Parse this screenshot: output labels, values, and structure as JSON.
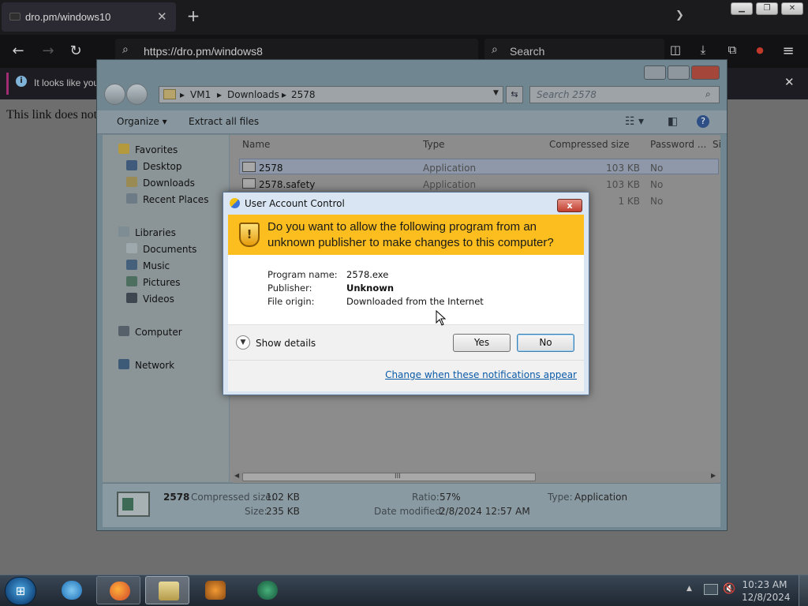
{
  "browser": {
    "tab_title": "dro.pm/windows10",
    "url": "https://dro.pm/windows8",
    "search_placeholder": "Search",
    "notice_text": "It looks like you",
    "page_text": "This link does not"
  },
  "explorer": {
    "breadcrumb": [
      "VM1",
      "Downloads",
      "2578"
    ],
    "search_placeholder": "Search 2578",
    "commands": {
      "organize": "Organize",
      "extract_all": "Extract all files"
    },
    "nav": {
      "favorites": "Favorites",
      "favorites_items": [
        "Desktop",
        "Downloads",
        "Recent Places"
      ],
      "libraries": "Libraries",
      "libraries_items": [
        "Documents",
        "Music",
        "Pictures",
        "Videos"
      ],
      "computer": "Computer",
      "network": "Network"
    },
    "columns": [
      "Name",
      "Type",
      "Compressed size",
      "Password ...",
      "Si"
    ],
    "files": [
      {
        "name": "2578",
        "type": "Application",
        "size": "103 KB",
        "password": "No"
      },
      {
        "name": "2578.safety",
        "type": "Application",
        "size": "103 KB",
        "password": "No"
      },
      {
        "name": "",
        "type": "",
        "size": "1 KB",
        "password": "No"
      }
    ],
    "details": {
      "name": "2578",
      "compressed_size_label": "Compressed size:",
      "compressed_size": "102 KB",
      "size_label": "Size:",
      "size": "235 KB",
      "ratio_label": "Ratio:",
      "ratio": "57%",
      "date_label": "Date modified:",
      "date": "2/8/2024 12:57 AM",
      "type_label": "Type:",
      "type": "Application"
    }
  },
  "uac": {
    "title": "User Account Control",
    "close_label": "x",
    "question": "Do you want to allow the following program from an unknown publisher to make changes to this computer?",
    "program_name_label": "Program name:",
    "program_name": "2578.exe",
    "publisher_label": "Publisher:",
    "publisher": "Unknown",
    "file_origin_label": "File origin:",
    "file_origin": "Downloaded from the Internet",
    "show_details": "Show details",
    "yes": "Yes",
    "no": "No",
    "link": "Change when these notifications appear"
  },
  "taskbar": {
    "time": "10:23 AM",
    "date": "12/8/2024"
  },
  "colors": {
    "uac_banner": "#fcbe1e",
    "link": "#0a5aa8"
  }
}
